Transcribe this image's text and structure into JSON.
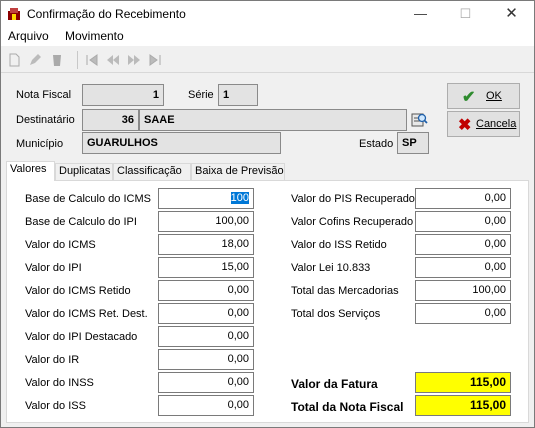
{
  "window": {
    "title": "Confirmação do Recebimento"
  },
  "menu": {
    "arquivo": "Arquivo",
    "movimento": "Movimento"
  },
  "header": {
    "nota_fiscal_label": "Nota Fiscal",
    "nota_fiscal_value": "1",
    "serie_label": "Série",
    "serie_value": "1",
    "destinatario_label": "Destinatário",
    "destinatario_code": "36",
    "destinatario_name": "SAAE",
    "municipio_label": "Município",
    "municipio_value": "GUARULHOS",
    "estado_label": "Estado",
    "estado_value": "SP"
  },
  "buttons": {
    "ok": "OK",
    "cancel": "Cancela"
  },
  "tabs": [
    {
      "label": "Valores"
    },
    {
      "label": "Duplicatas"
    },
    {
      "label": "Classificação"
    },
    {
      "label": "Baixa de Previsão"
    }
  ],
  "left_fields": [
    {
      "label": "Base de Calculo do ICMS",
      "value": "100"
    },
    {
      "label": "Base de Calculo do IPI",
      "value": "100,00"
    },
    {
      "label": "Valor do ICMS",
      "value": "18,00"
    },
    {
      "label": "Valor do IPI",
      "value": "15,00"
    },
    {
      "label": "Valor do ICMS Retido",
      "value": "0,00"
    },
    {
      "label": "Valor do ICMS Ret. Dest.",
      "value": "0,00"
    },
    {
      "label": "Valor do IPI Destacado",
      "value": "0,00"
    },
    {
      "label": "Valor do IR",
      "value": "0,00"
    },
    {
      "label": "Valor do INSS",
      "value": "0,00"
    },
    {
      "label": "Valor do ISS",
      "value": "0,00"
    }
  ],
  "right_fields": [
    {
      "label": "Valor do PIS Recuperado",
      "value": "0,00"
    },
    {
      "label": "Valor Cofins Recuperado",
      "value": "0,00"
    },
    {
      "label": "Valor do ISS Retido",
      "value": "0,00"
    },
    {
      "label": "Valor Lei 10.833",
      "value": "0,00"
    },
    {
      "label": "Total das Mercadorias",
      "value": "100,00"
    },
    {
      "label": "Total dos Serviços",
      "value": "0,00"
    }
  ],
  "totals": [
    {
      "label": "Valor da Fatura",
      "value": "115,00"
    },
    {
      "label": "Total da Nota Fiscal",
      "value": "115,00"
    }
  ],
  "colors": {
    "highlight_yellow": "#ffff00",
    "selection_blue": "#0078d7",
    "ok_check": "#2e8b2e",
    "cancel_x": "#c00000"
  }
}
